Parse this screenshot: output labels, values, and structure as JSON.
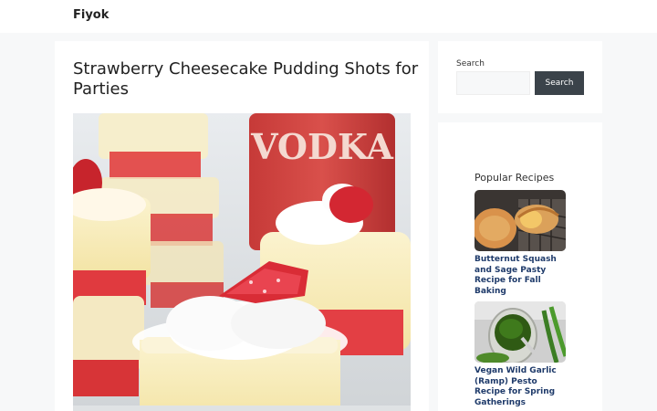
{
  "header": {
    "site_title": "Fiyok"
  },
  "article": {
    "title": "Strawberry Cheesecake Pudding Shots for Parties",
    "hero_image_brand": "VODKA"
  },
  "search": {
    "label": "Search",
    "placeholder": "",
    "button_label": "Search"
  },
  "popular": {
    "title": "Popular Recipes",
    "items": [
      {
        "title": "Butternut Squash and Sage Pasty Recipe for Fall Baking"
      },
      {
        "title": "Vegan Wild Garlic (Ramp) Pesto Recipe for Spring Gatherings"
      }
    ]
  },
  "colors": {
    "accent_button": "#3b434a",
    "link": "#1e3a6a",
    "background": "#f7f8f9"
  }
}
